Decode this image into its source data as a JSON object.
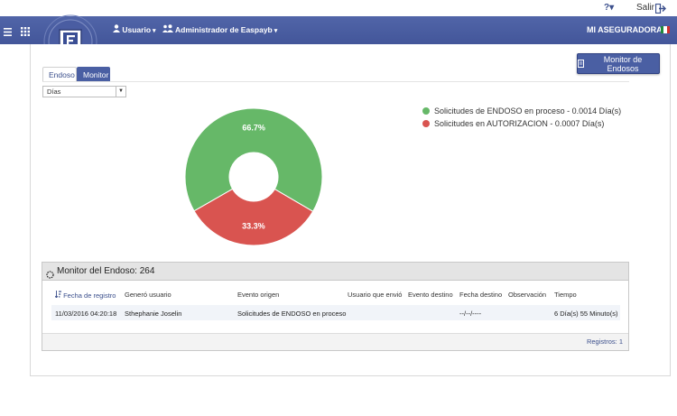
{
  "topbar": {
    "help_icon": "help-icon",
    "logout_label": "Salir"
  },
  "nav": {
    "user_menu": "Usuario",
    "admin_menu": "Administrador de Easpayb",
    "brand": "MI ASEGURADORA",
    "accent": "#4a5fa3"
  },
  "actions": {
    "monitor_button": "Monitor de Endosos"
  },
  "tabs": [
    {
      "label": "Endoso",
      "active": false
    },
    {
      "label": "Monitor",
      "active": true
    }
  ],
  "period_select": {
    "value": "Días"
  },
  "chart_data": {
    "type": "pie",
    "donut": true,
    "slices": [
      {
        "label": "Solicitudes de ENDOSO en proceso - 0.0014 Día(s)",
        "percent": 66.7,
        "percent_label": "66.7%",
        "color": "#66b868"
      },
      {
        "label": "Solicitudes en AUTORIZACION - 0.0007 Día(s)",
        "percent": 33.3,
        "percent_label": "33.3%",
        "color": "#d95450"
      }
    ],
    "legend_position": "right"
  },
  "monitor_table": {
    "title": "Monitor del Endoso: 264",
    "columns": [
      "Fecha de registro",
      "Generó usuario",
      "Evento origen",
      "Usuario que envió",
      "Evento destino",
      "Fecha destino",
      "Observación",
      "Tiempo"
    ],
    "rows": [
      [
        "11/03/2016 04:20:18",
        "Sthephanie Joselin",
        "Solicitudes de ENDOSO en proceso",
        "",
        "",
        "--/--/----",
        "",
        "6 Día(s) 55 Minuto(s)"
      ]
    ],
    "footer": "Registros: 1"
  }
}
